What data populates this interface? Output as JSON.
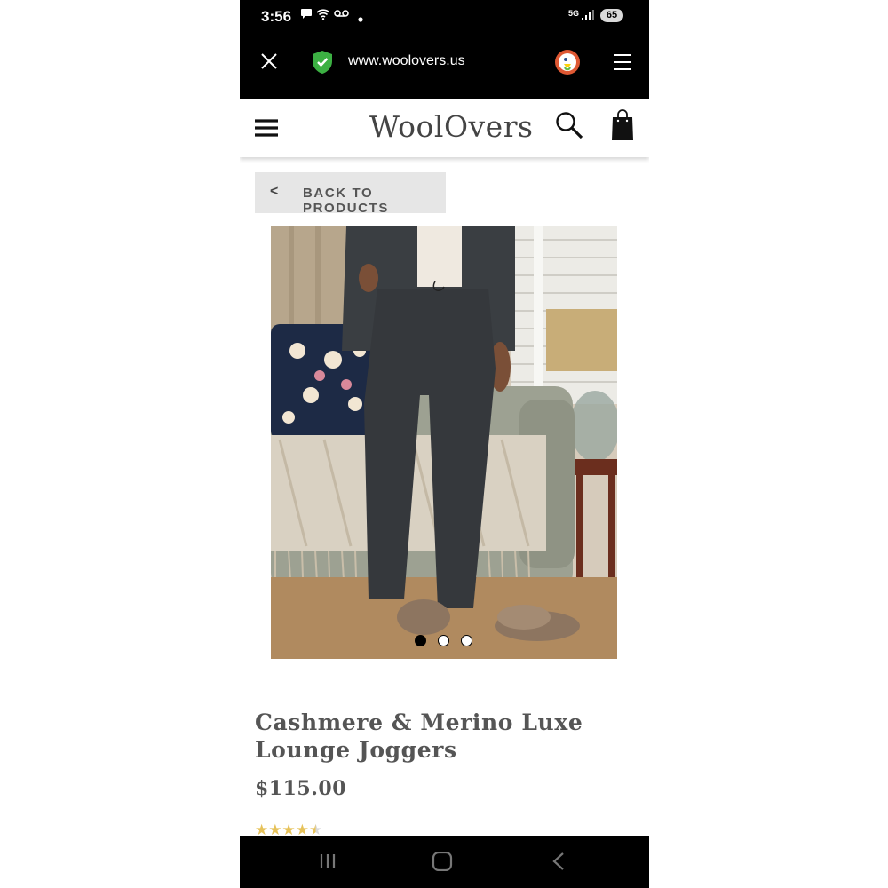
{
  "status_bar": {
    "time": "3:56",
    "network": "5G",
    "battery": "65"
  },
  "browser": {
    "url": "www.woolovers.us"
  },
  "site": {
    "logo": "WoolOvers"
  },
  "back_button": {
    "chevron": "<",
    "label": "BACK TO PRODUCTS"
  },
  "carousel": {
    "total_images": 3,
    "active_index": 1
  },
  "product": {
    "title": "Cashmere & Merino Luxe Lounge Joggers",
    "price": "$115.00",
    "rating": 4.5
  },
  "icons": {
    "close": "close-icon",
    "shield": "shield-check-icon",
    "browser_logo": "duckduckgo-icon",
    "browser_menu": "menu-icon",
    "site_menu": "hamburger-icon",
    "search": "search-icon",
    "cart": "shopping-bag-icon",
    "nav_recents": "recents-icon",
    "nav_home": "home-icon",
    "nav_back": "back-icon"
  },
  "colors": {
    "accent_star": "#e6c25a",
    "shield_green": "#3cb043",
    "text_dark": "#555555"
  }
}
